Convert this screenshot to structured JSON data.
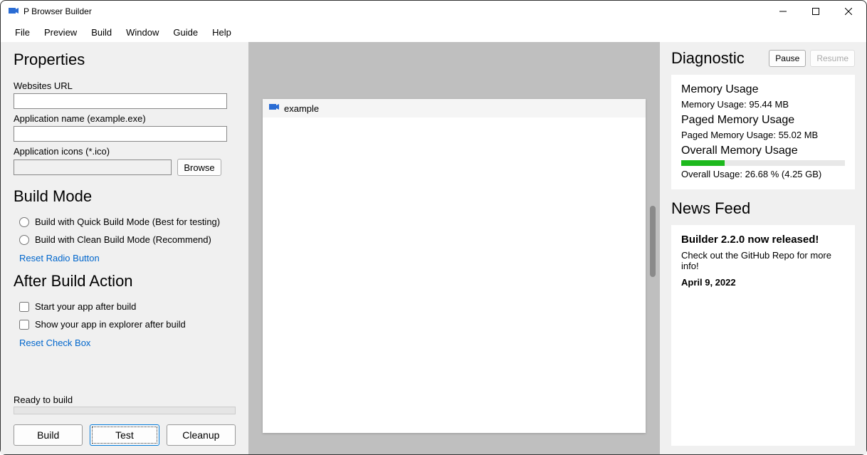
{
  "window": {
    "title": "P Browser Builder"
  },
  "menus": {
    "file": "File",
    "preview": "Preview",
    "build": "Build",
    "window": "Window",
    "guide": "Guide",
    "help": "Help"
  },
  "properties": {
    "heading": "Properties",
    "url_label": "Websites URL",
    "url_value": "",
    "app_name_label": "Application name (example.exe)",
    "app_name_value": "",
    "icons_label": "Application icons (*.ico)",
    "icons_value": "",
    "browse_label": "Browse"
  },
  "build_mode": {
    "heading": "Build Mode",
    "quick_label": "Build with Quick Build Mode (Best for testing)",
    "clean_label": "Build with Clean Build Mode (Recommend)",
    "reset_label": "Reset Radio Button"
  },
  "after_build": {
    "heading": "After Build Action",
    "start_label": "Start your app after build",
    "show_label": "Show your app in explorer after build",
    "reset_label": "Reset Check Box"
  },
  "status": {
    "text": "Ready to build"
  },
  "actions": {
    "build": "Build",
    "test": "Test",
    "cleanup": "Cleanup"
  },
  "preview": {
    "title": "example"
  },
  "diagnostic": {
    "heading": "Diagnostic",
    "pause": "Pause",
    "resume": "Resume",
    "mem_title": "Memory Usage",
    "mem_text": "Memory Usage: 95.44 MB",
    "paged_title": "Paged Memory Usage",
    "paged_text": "Paged Memory Usage: 55.02 MB",
    "overall_title": "Overall Memory Usage",
    "overall_percent": 26.68,
    "overall_text": "Overall Usage: 26.68 % (4.25 GB)"
  },
  "news": {
    "heading": "News Feed",
    "title": "Builder 2.2.0 now released!",
    "body": "Check out the GitHub Repo for more info!",
    "date": "April 9, 2022"
  }
}
